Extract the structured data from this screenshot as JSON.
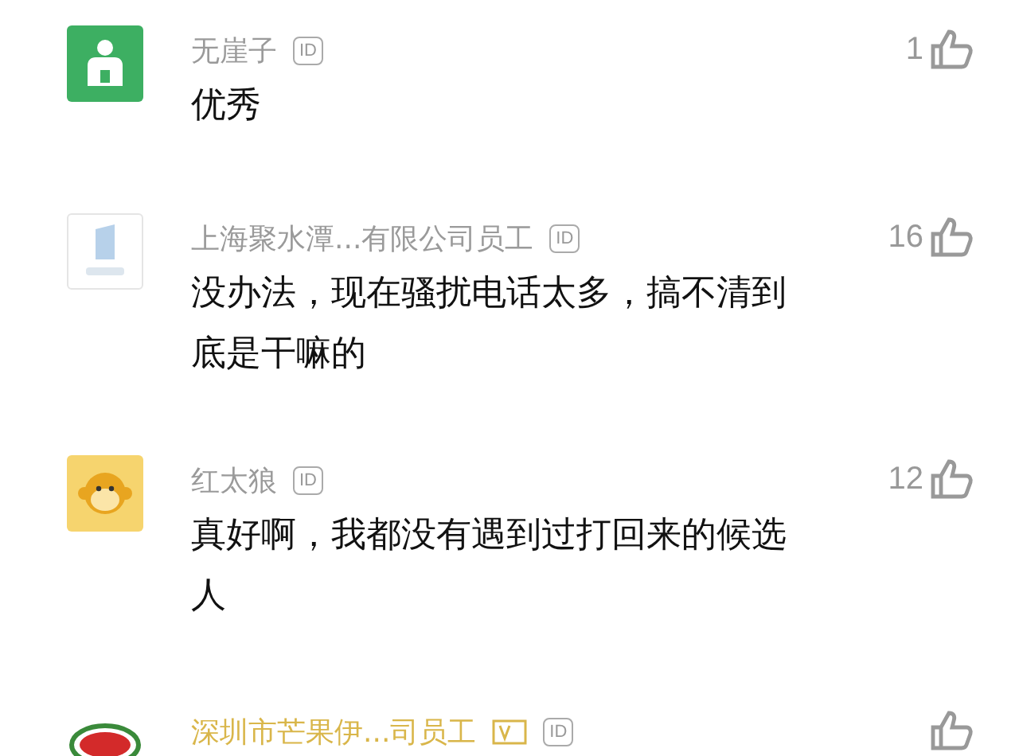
{
  "comments": [
    {
      "kind": "person",
      "name": "无崖子",
      "verified": false,
      "badge": "ID",
      "likes": "1",
      "text": "优秀"
    },
    {
      "kind": "logo",
      "name": "上海聚水潭...有限公司员工",
      "verified": false,
      "badge": "ID",
      "likes": "16",
      "text": "没办法，现在骚扰电话太多，搞不清到底是干嘛的"
    },
    {
      "kind": "monkey",
      "name": "红太狼",
      "verified": false,
      "badge": "ID",
      "likes": "12",
      "text": "真好啊，我都没有遇到过打回来的候选人"
    },
    {
      "kind": "brand",
      "name": "深圳市芒果伊...司员工",
      "verified": true,
      "badge": "ID"
    }
  ]
}
